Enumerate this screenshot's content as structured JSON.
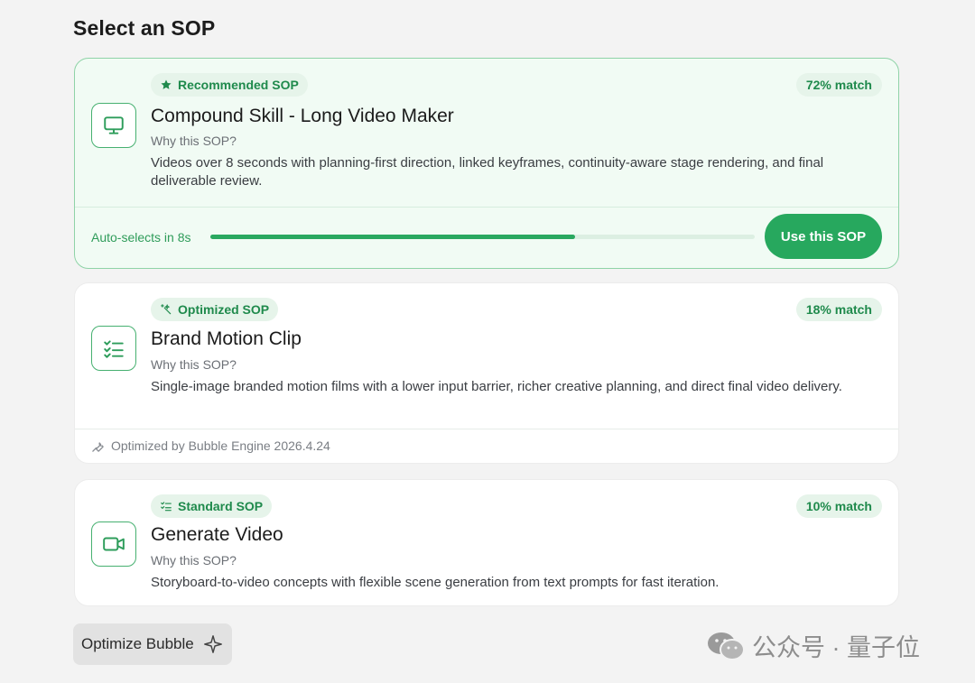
{
  "page": {
    "title": "Select an SOP"
  },
  "colors": {
    "accent": "#27a85e",
    "badge_bg": "#e6f4ea",
    "badge_text": "#1f8a4c",
    "recommended_bg": "#f1fbf4",
    "recommended_border": "#8fd3a7"
  },
  "cards": [
    {
      "badge": "Recommended SOP",
      "badge_icon": "star-icon",
      "match": "72% match",
      "icon": "monitor-icon",
      "title": "Compound Skill - Long Video Maker",
      "why": "Why this SOP?",
      "description": "Videos over 8 seconds with planning-first direction, linked keyframes, continuity-aware stage rendering, and final deliverable review.",
      "auto_select_label": "Auto-selects in 8s",
      "auto_select_progress": 0.67,
      "action_label": "Use this SOP"
    },
    {
      "badge": "Optimized SOP",
      "badge_icon": "sparkles-icon",
      "match": "18% match",
      "icon": "checklist-icon",
      "title": "Brand Motion Clip",
      "why": "Why this SOP?",
      "description": "Single-image branded motion films with a lower input barrier, richer creative planning, and direct final video delivery.",
      "footer_icon": "wrench-icon",
      "footer_note": "Optimized by Bubble Engine 2026.4.24"
    },
    {
      "badge": "Standard SOP",
      "badge_icon": "list-check-icon",
      "match": "10% match",
      "icon": "video-camera-icon",
      "title": "Generate Video",
      "why": "Why this SOP?",
      "description": "Storyboard-to-video concepts with flexible scene generation from text prompts for fast iteration."
    }
  ],
  "optimize_button": {
    "label": "Optimize Bubble",
    "icon": "sparkle-icon"
  },
  "watermark": {
    "text": "公众号 · 量子位",
    "icon": "wechat-icon"
  }
}
